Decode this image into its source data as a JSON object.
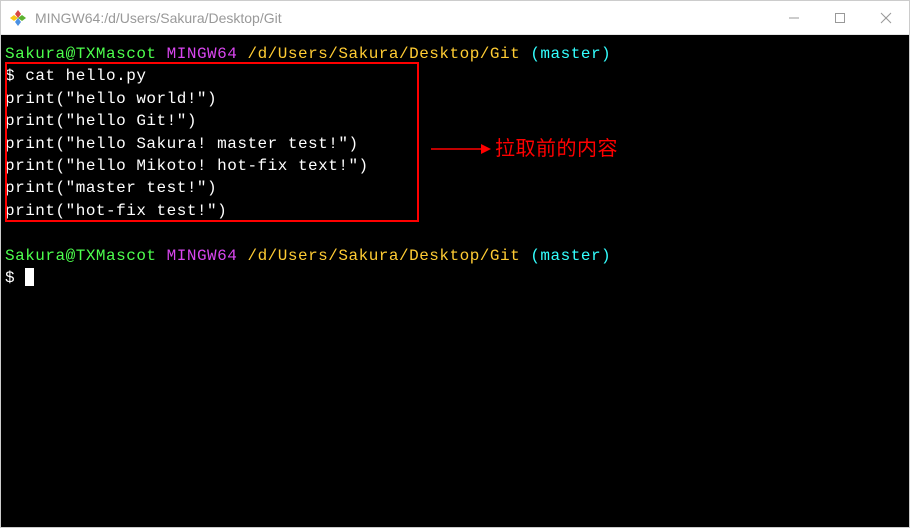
{
  "window": {
    "title": "MINGW64:/d/Users/Sakura/Desktop/Git"
  },
  "prompt1": {
    "userhost": "Sakura@TXMascot",
    "env": "MINGW64",
    "path": "/d/Users/Sakura/Desktop/Git",
    "branch": "(master)",
    "command": "cat hello.py"
  },
  "output": {
    "l1": "print(\"hello world!\")",
    "l2": "print(\"hello Git!\")",
    "l3": "print(\"hello Sakura! master test!\")",
    "l4": "print(\"hello Mikoto! hot-fix text!\")",
    "l5": "print(\"master test!\")",
    "l6": "print(\"hot-fix test!\")"
  },
  "prompt2": {
    "userhost": "Sakura@TXMascot",
    "env": "MINGW64",
    "path": "/d/Users/Sakura/Desktop/Git",
    "branch": "(master)"
  },
  "annotation": {
    "label": "拉取前的内容"
  },
  "symbols": {
    "dollar": "$",
    "space": " "
  }
}
